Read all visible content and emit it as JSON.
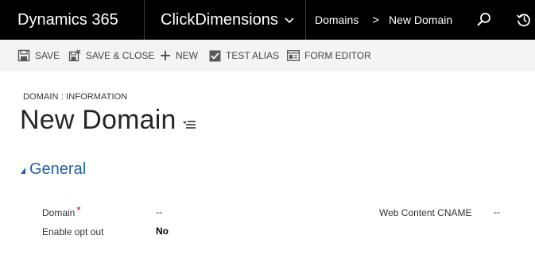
{
  "nav": {
    "brand": "Dynamics 365",
    "app_name": "ClickDimensions",
    "breadcrumb": [
      "Domains",
      "New Domain"
    ],
    "breadcrumb_separator": ">"
  },
  "toolbar": {
    "save": "SAVE",
    "save_close": "SAVE & CLOSE",
    "new": "NEW",
    "test_alias": "TEST ALIAS",
    "form_editor": "FORM EDITOR"
  },
  "header": {
    "entity_label": "DOMAIN : INFORMATION",
    "title": "New Domain"
  },
  "section": {
    "title": "General"
  },
  "fields": {
    "domain": {
      "label": "Domain",
      "required_marker": "*",
      "value": "--"
    },
    "enable_opt_out": {
      "label": "Enable opt out",
      "value": "No"
    },
    "web_content_cname": {
      "label": "Web Content CNAME",
      "value": "--"
    }
  },
  "colors": {
    "nav_bg": "#000000",
    "accent_blue": "#1f5fa8",
    "required_red": "#c00000"
  }
}
